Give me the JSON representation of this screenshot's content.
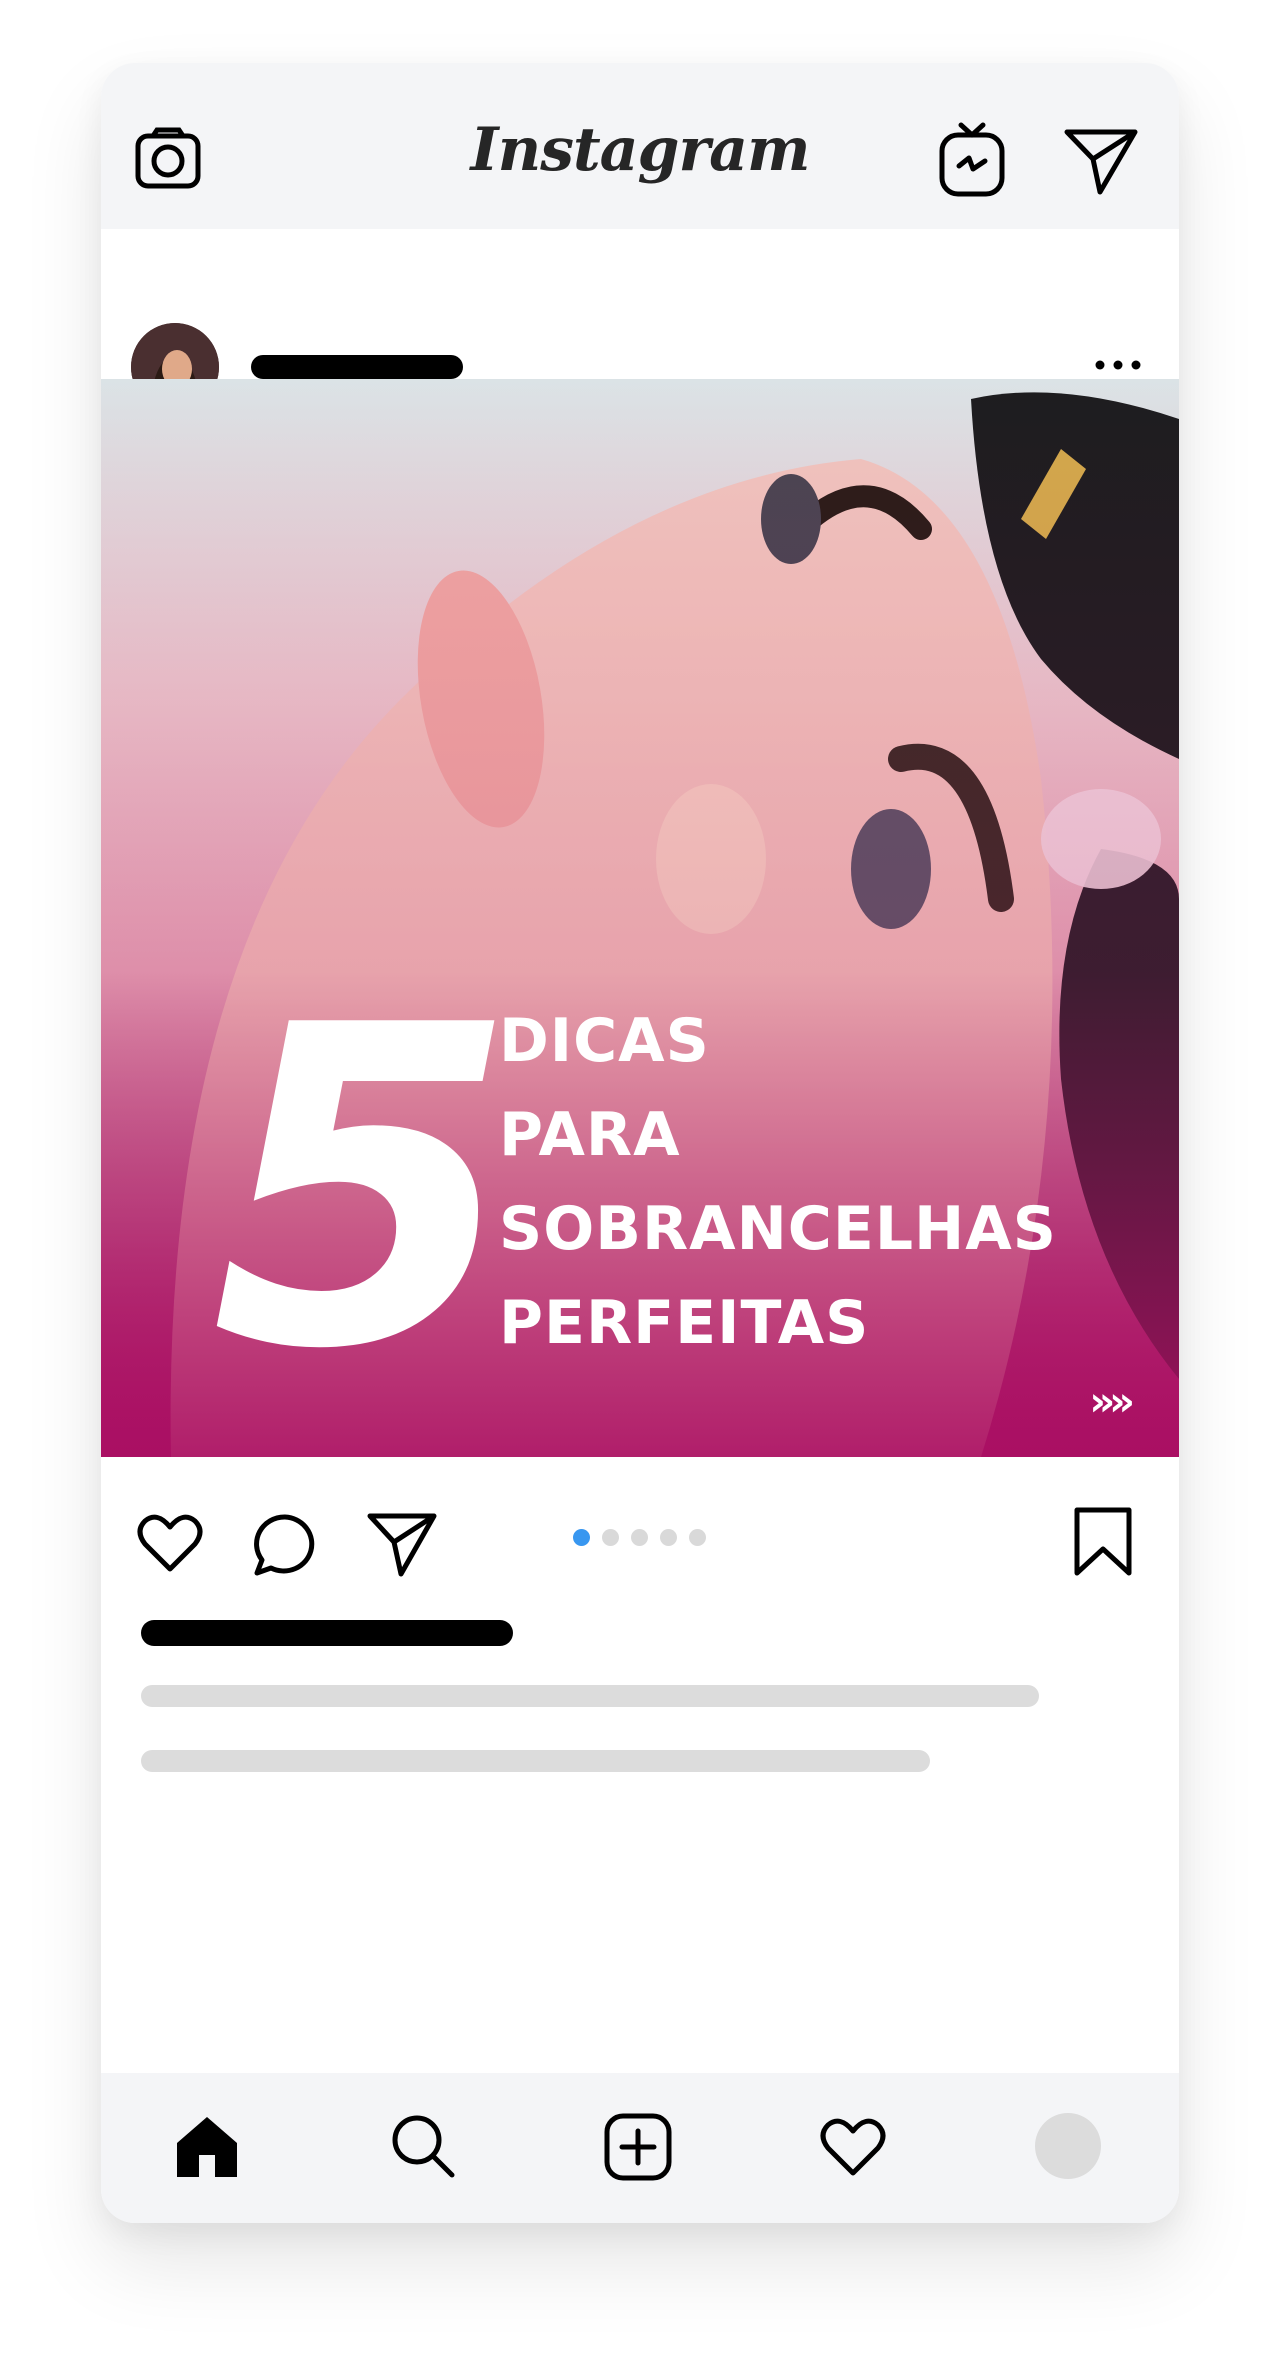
{
  "app": {
    "name": "Instagram"
  },
  "header": {
    "logo_text": "Instagram",
    "icons": [
      "camera-icon",
      "igtv-icon",
      "direct-message-icon"
    ]
  },
  "post": {
    "headline_number": "5",
    "headline_lines": [
      "DICAS",
      "PARA",
      "SOBRANCELHAS",
      "PERFEITAS"
    ],
    "next_indicator": "»»",
    "carousel": {
      "total_slides": 5,
      "active_slide": 1
    },
    "colors": {
      "overlay": "#aa0f63",
      "active_dot": "#3897f0"
    }
  },
  "actions": {
    "icons": [
      "heart-icon",
      "comment-icon",
      "share-icon",
      "bookmark-icon"
    ]
  },
  "bottom_nav": {
    "icons": [
      "home-icon",
      "search-icon",
      "new-post-icon",
      "activity-icon",
      "profile-avatar"
    ]
  }
}
